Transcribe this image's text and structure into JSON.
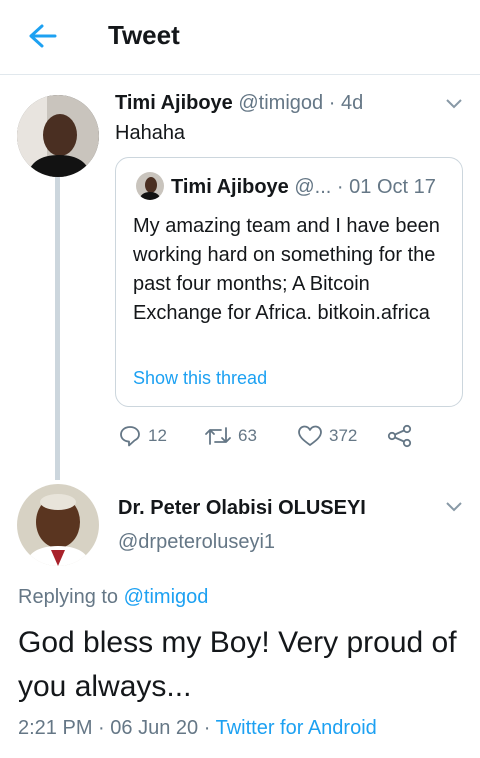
{
  "header": {
    "title": "Tweet"
  },
  "tweet": {
    "author_name": "Timi Ajiboye",
    "author_handle": "@timigod",
    "separator": "·",
    "time": "4d",
    "text": "Hahaha",
    "quoted": {
      "author_name": "Timi Ajiboye",
      "author_handle": "@...",
      "separator": "·",
      "date": "01 Oct 17",
      "text": "My amazing team and I have been working hard on something for the past four months; A Bitcoin Exchange for Africa. bitkoin.africa",
      "show_thread": "Show this thread"
    },
    "actions": {
      "replies": "12",
      "retweets": "63",
      "likes": "372"
    }
  },
  "reply": {
    "author_name": "Dr. Peter Olabisi OLUSEYI",
    "author_handle": "@drpeteroluseyi1",
    "replying_to_prefix": "Replying to",
    "replying_to_handle": "@timigod",
    "text": "God bless my Boy! Very proud of you always...",
    "time": "2:21 PM",
    "separator1": "·",
    "date": "06 Jun 20",
    "separator2": "·",
    "source": "Twitter for Android"
  },
  "colors": {
    "accent": "#1da1f2",
    "muted": "#657786",
    "text": "#14171a",
    "border": "#e1e8ed"
  },
  "icons": [
    "back-arrow-icon",
    "chevron-down-icon",
    "reply-icon",
    "retweet-icon",
    "like-icon",
    "share-icon"
  ]
}
